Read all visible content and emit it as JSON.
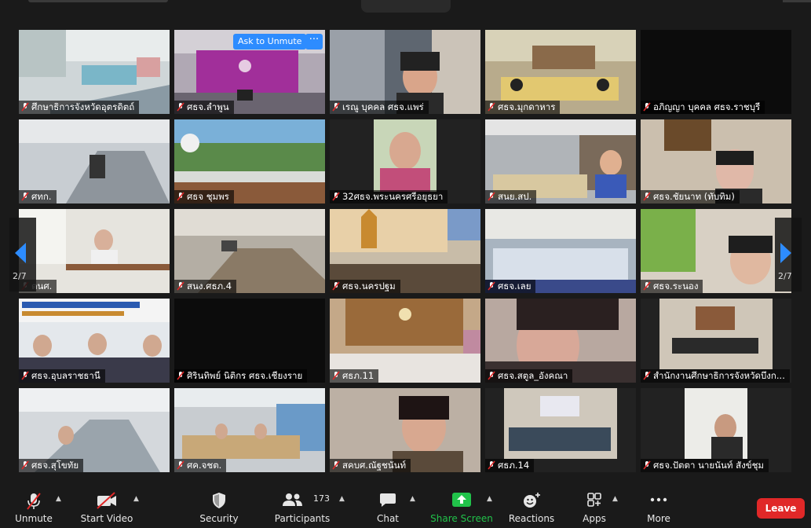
{
  "meeting": {
    "participant_tiles": [
      {
        "name": "ศึกษาธิการจังหวัดอุตรดิตถ์"
      },
      {
        "name": "ศธจ.ลำพูน"
      },
      {
        "name": "เรณู บุคคล ศธจ.แพร่"
      },
      {
        "name": "ศธจ.มุกดาหาร"
      },
      {
        "name": "อภิญญา บุคคล ศธจ.ราชบุรี"
      },
      {
        "name": "ศทก."
      },
      {
        "name": "ศธจ ชุมพร"
      },
      {
        "name": "32ศธจ.พระนครศรีอยุธยา"
      },
      {
        "name": "สนย.สป."
      },
      {
        "name": "ศธจ.ชัยนาท (ทับทิม)"
      },
      {
        "name": "ตนศ."
      },
      {
        "name": "สนง.ศธภ.4"
      },
      {
        "name": "ศธจ.นครปฐม"
      },
      {
        "name": "ศธจ.เลย"
      },
      {
        "name": "ศธจ.ระนอง"
      },
      {
        "name": "ศธจ.อุบลราชธานี"
      },
      {
        "name": "ศิรินทิพย์ นิติกร ศธจ.เชียงราย"
      },
      {
        "name": "ศธภ.11"
      },
      {
        "name": "ศธจ.สตูล_อังคณา"
      },
      {
        "name": "สำนักงานศึกษาธิการจังหวัดบึงก..."
      },
      {
        "name": "ศธจ.สุโขทัย"
      },
      {
        "name": "ศค.จชต."
      },
      {
        "name": "สคบศ.ณัฐชนันท์"
      },
      {
        "name": "ศธภ.14"
      },
      {
        "name": "ศธจ.ปัตตา นายนันท์ สังข์ชุม"
      }
    ],
    "ask_to_unmute_label": "Ask to Unmute",
    "more_options_label": "···",
    "page_indicator_left": "2/7",
    "page_indicator_right": "2/7"
  },
  "toolbar": {
    "unmute_label": "Unmute",
    "start_video_label": "Start Video",
    "security_label": "Security",
    "participants_label": "Participants",
    "participants_count": "173",
    "chat_label": "Chat",
    "share_screen_label": "Share Screen",
    "reactions_label": "Reactions",
    "apps_label": "Apps",
    "more_label": "More",
    "leave_label": "Leave",
    "share_screen_color": "#21c24a",
    "leave_color": "#e02828",
    "accent_color": "#2d8cff"
  }
}
